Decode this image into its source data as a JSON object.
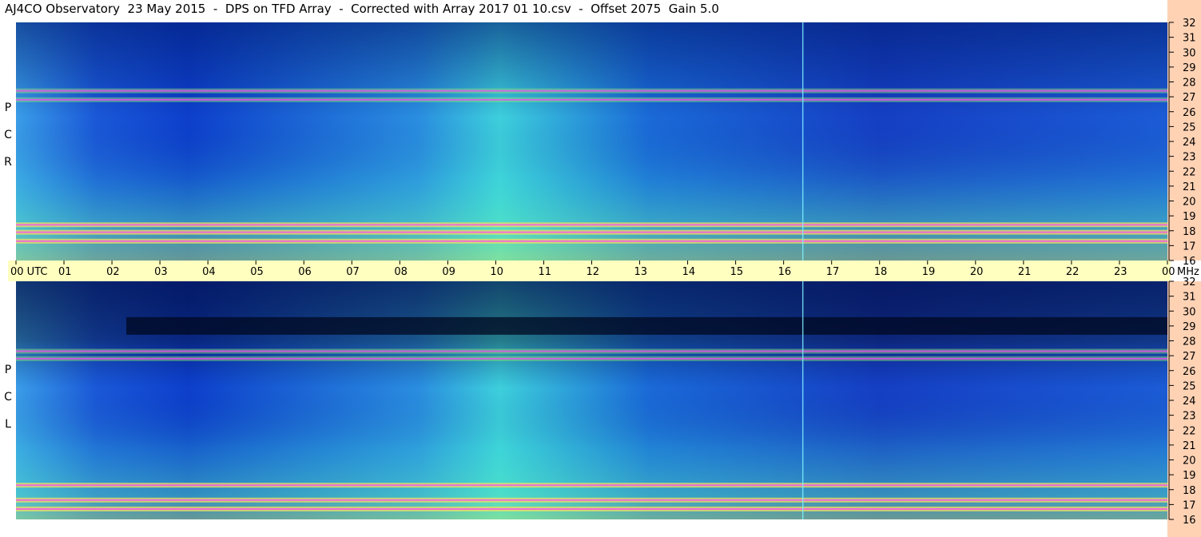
{
  "title": "AJ4CO Observatory  23 May 2015  -  DPS on TFD Array  -  Corrected with Array 2017 01 10.csv  -  Offset 2075  Gain 5.0",
  "panels": [
    {
      "label_letters": [
        "P",
        "C",
        "R"
      ]
    },
    {
      "label_letters": [
        "P",
        "C",
        "L"
      ]
    }
  ],
  "colors": {
    "time_axis_band": "#ffffc0",
    "freq_axis_band": "#ffd2b4",
    "spectrogram_low": "#000033",
    "spectrogram_mid": "#1050d0",
    "spectrogram_high": "#30e8d0",
    "interference": "#ff40ff"
  },
  "chart_data": {
    "type": "heatmap",
    "x_tick_labels": [
      "00  UTC",
      "01",
      "02",
      "03",
      "04",
      "05",
      "06",
      "07",
      "08",
      "09",
      "10",
      "11",
      "12",
      "13",
      "14",
      "15",
      "16",
      "17",
      "18",
      "19",
      "20",
      "21",
      "22",
      "23",
      "00"
    ],
    "x_unit_label": "MHz",
    "y_tick_labels": [
      "32",
      "31",
      "30",
      "29",
      "28",
      "27",
      "26",
      "25",
      "24",
      "23",
      "22",
      "21",
      "20",
      "19",
      "18",
      "17",
      "16"
    ],
    "xlim_hours": [
      0,
      24
    ],
    "ylim_mhz": [
      16,
      32
    ],
    "series": [
      {
        "name": "RCP",
        "bright_bands_mhz": [
          17.3,
          17.9,
          18.4,
          26.8,
          27.4
        ]
      },
      {
        "name": "LCP",
        "dark_band_mhz": 29.0,
        "bright_bands_mhz": [
          16.7,
          17.3,
          18.3,
          26.8,
          27.3
        ]
      }
    ],
    "vertical_line_hour": 16.4
  }
}
